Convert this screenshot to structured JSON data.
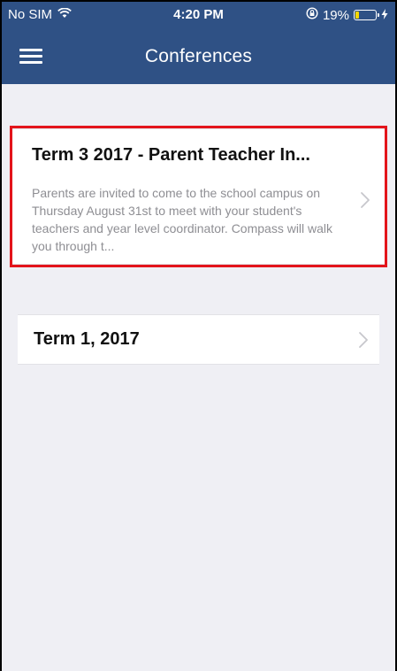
{
  "status_bar": {
    "carrier": "No SIM",
    "time": "4:20 PM",
    "battery_percent": "19%",
    "battery_level": 0.19
  },
  "nav": {
    "title": "Conferences"
  },
  "conferences": [
    {
      "title": "Term 3 2017 - Parent Teacher In...",
      "description": "Parents are invited to come to the school campus on Thursday August 31st to meet with your student's teachers and year level coordinator. Compass will walk you through t..."
    },
    {
      "title": "Term 1, 2017",
      "description": ""
    }
  ],
  "colors": {
    "header": "#2f5185",
    "highlight": "#e3141b",
    "background": "#efeff4"
  }
}
